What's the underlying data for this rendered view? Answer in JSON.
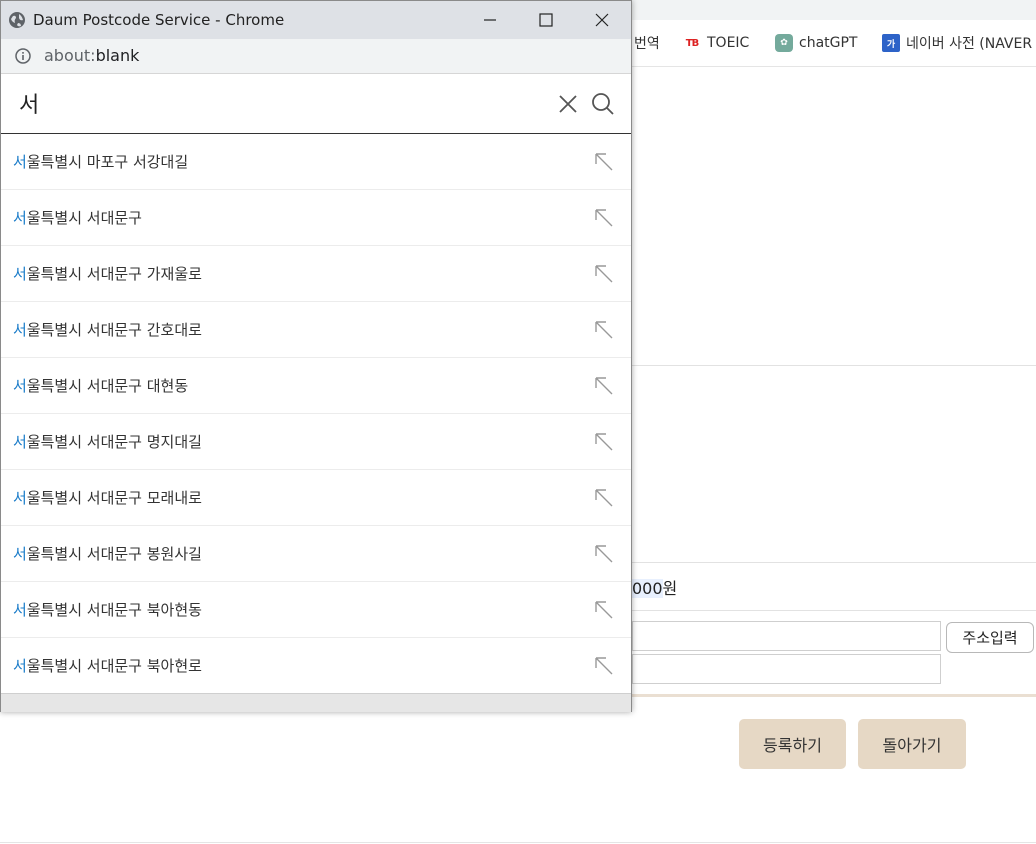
{
  "page": {
    "bookmarks": [
      {
        "label": "번역",
        "icon": "translate-icon"
      },
      {
        "label": "TOEIC",
        "icon": "toeic-icon",
        "icon_text": "TB"
      },
      {
        "label": "chatGPT",
        "icon": "chatgpt-icon",
        "icon_text": "✿"
      },
      {
        "label": "네이버 사전 (NAVER",
        "icon": "naver-dictionary-icon",
        "icon_text": "가"
      }
    ],
    "price": {
      "value": "000",
      "unit": "원"
    },
    "address_button": "주소입력",
    "register_button": "등록하기",
    "back_button": "돌아가기"
  },
  "popup": {
    "window_title": "Daum Postcode Service - Chrome",
    "url_prefix": "about:",
    "url_rest": "blank",
    "search_value": "서",
    "suggestions": [
      {
        "match": "서",
        "rest": "울특별시 마포구 서강대길"
      },
      {
        "match": "서",
        "rest": "울특별시 서대문구"
      },
      {
        "match": "서",
        "rest": "울특별시 서대문구 가재울로"
      },
      {
        "match": "서",
        "rest": "울특별시 서대문구 간호대로"
      },
      {
        "match": "서",
        "rest": "울특별시 서대문구 대현동"
      },
      {
        "match": "서",
        "rest": "울특별시 서대문구 명지대길"
      },
      {
        "match": "서",
        "rest": "울특별시 서대문구 모래내로"
      },
      {
        "match": "서",
        "rest": "울특별시 서대문구 봉원사길"
      },
      {
        "match": "서",
        "rest": "울특별시 서대문구 북아현동"
      },
      {
        "match": "서",
        "rest": "울특별시 서대문구 북아현로"
      }
    ]
  },
  "colors": {
    "match_highlight": "#1a7cc9",
    "action_button_bg": "#e6d8c5",
    "titlebar_bg": "#dee1e6"
  }
}
